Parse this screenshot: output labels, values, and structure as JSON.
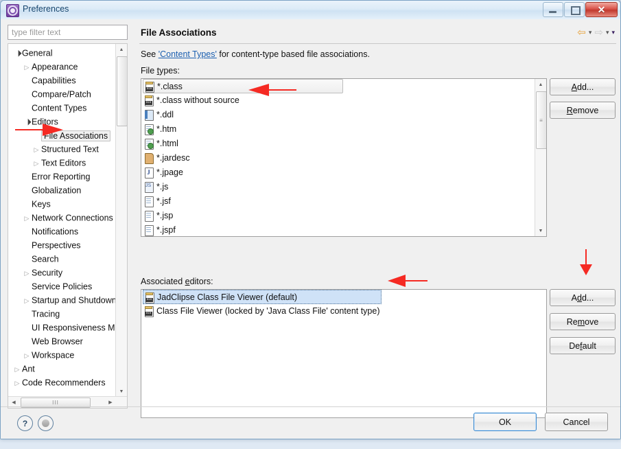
{
  "window": {
    "title": "Preferences",
    "icon": "preferences-gear-icon",
    "controls": {
      "minimize": "–",
      "maximize": "□",
      "close": "✕"
    }
  },
  "sidebar": {
    "filter": {
      "placeholder": "type filter text",
      "value": ""
    },
    "items": [
      {
        "label": "General",
        "indent": 0,
        "twisty": "open",
        "selected": false
      },
      {
        "label": "Appearance",
        "indent": 1,
        "twisty": "closed",
        "selected": false
      },
      {
        "label": "Capabilities",
        "indent": 1,
        "twisty": "none",
        "selected": false
      },
      {
        "label": "Compare/Patch",
        "indent": 1,
        "twisty": "none",
        "selected": false
      },
      {
        "label": "Content Types",
        "indent": 1,
        "twisty": "none",
        "selected": false
      },
      {
        "label": "Editors",
        "indent": 1,
        "twisty": "open",
        "selected": false
      },
      {
        "label": "File Associations",
        "indent": 2,
        "twisty": "none",
        "selected": true
      },
      {
        "label": "Structured Text",
        "indent": 2,
        "twisty": "closed",
        "selected": false
      },
      {
        "label": "Text Editors",
        "indent": 2,
        "twisty": "closed",
        "selected": false
      },
      {
        "label": "Error Reporting",
        "indent": 1,
        "twisty": "none",
        "selected": false
      },
      {
        "label": "Globalization",
        "indent": 1,
        "twisty": "none",
        "selected": false
      },
      {
        "label": "Keys",
        "indent": 1,
        "twisty": "none",
        "selected": false
      },
      {
        "label": "Network Connections",
        "indent": 1,
        "twisty": "closed",
        "selected": false
      },
      {
        "label": "Notifications",
        "indent": 1,
        "twisty": "none",
        "selected": false
      },
      {
        "label": "Perspectives",
        "indent": 1,
        "twisty": "none",
        "selected": false
      },
      {
        "label": "Search",
        "indent": 1,
        "twisty": "none",
        "selected": false
      },
      {
        "label": "Security",
        "indent": 1,
        "twisty": "closed",
        "selected": false
      },
      {
        "label": "Service Policies",
        "indent": 1,
        "twisty": "none",
        "selected": false
      },
      {
        "label": "Startup and Shutdown",
        "indent": 1,
        "twisty": "closed",
        "selected": false
      },
      {
        "label": "Tracing",
        "indent": 1,
        "twisty": "none",
        "selected": false
      },
      {
        "label": "UI Responsiveness Monitoring",
        "indent": 1,
        "twisty": "none",
        "selected": false
      },
      {
        "label": "Web Browser",
        "indent": 1,
        "twisty": "none",
        "selected": false
      },
      {
        "label": "Workspace",
        "indent": 1,
        "twisty": "closed",
        "selected": false
      },
      {
        "label": "Ant",
        "indent": 0,
        "twisty": "closed",
        "selected": false
      },
      {
        "label": "Code Recommenders",
        "indent": 0,
        "twisty": "closed",
        "selected": false
      }
    ]
  },
  "page": {
    "title": "File Associations",
    "description_prefix": "See ",
    "description_link": "'Content Types'",
    "description_suffix": " for content-type based file associations.",
    "file_types_label": "File types:",
    "associated_editors_label": "Associated editors:",
    "nav": {
      "back": "⇦",
      "forward": "⇨",
      "caret": "▾"
    }
  },
  "file_types": {
    "items": [
      {
        "name": "*.class",
        "icon": "class-file-icon",
        "selected": true
      },
      {
        "name": "*.class without source",
        "icon": "class-file-icon",
        "selected": false
      },
      {
        "name": "*.ddl",
        "icon": "ddl-file-icon",
        "selected": false
      },
      {
        "name": "*.htm",
        "icon": "html-file-icon",
        "selected": false
      },
      {
        "name": "*.html",
        "icon": "html-file-icon",
        "selected": false
      },
      {
        "name": "*.jardesc",
        "icon": "jar-file-icon",
        "selected": false
      },
      {
        "name": "*.jpage",
        "icon": "jpage-file-icon",
        "selected": false
      },
      {
        "name": "*.js",
        "icon": "js-file-icon",
        "selected": false
      },
      {
        "name": "*.jsf",
        "icon": "text-file-icon",
        "selected": false
      },
      {
        "name": "*.jsp",
        "icon": "text-file-icon",
        "selected": false
      },
      {
        "name": "*.jspf",
        "icon": "text-file-icon",
        "selected": false
      }
    ],
    "buttons": {
      "add": "Add...",
      "remove": "Remove"
    }
  },
  "associated_editors": {
    "items": [
      {
        "name": "JadClipse Class File Viewer (default)",
        "icon": "class-file-icon",
        "selected": true
      },
      {
        "name": "Class File Viewer (locked by 'Java Class File' content type)",
        "icon": "class-file-icon",
        "selected": false
      }
    ],
    "buttons": {
      "add": "Add...",
      "remove": "Remove",
      "default": "Default"
    }
  },
  "footer": {
    "help_icon": "?",
    "restore_icon": "restore-defaults-icon",
    "ok": "OK",
    "cancel": "Cancel"
  },
  "colors": {
    "accent_blue": "#3c8ad0",
    "link_blue": "#1b5fb0",
    "selection_blue": "#cfe2f7",
    "nav_back_orange": "#e8a33d",
    "annotation_red": "#f52a23",
    "close_red": "#c0392f"
  },
  "annotations": {
    "arrow_color": "#f52a23",
    "arrows": [
      {
        "target": "sidebar-item-file-associations",
        "direction": "right"
      },
      {
        "target": "file-type-class-row",
        "direction": "left"
      },
      {
        "target": "add-editor-button",
        "direction": "down"
      },
      {
        "target": "associated-editor-jadclipse-row",
        "direction": "left"
      }
    ]
  }
}
